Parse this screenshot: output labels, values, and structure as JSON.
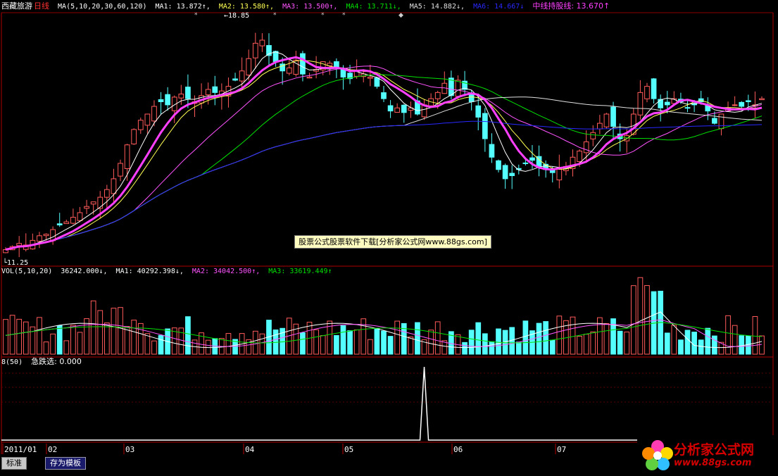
{
  "header": {
    "stock_name": "西藏旅游",
    "period": "日线",
    "ma_params": "MA(5,10,20,30,60,120)",
    "ma1": "MA1: 13.872↑,",
    "ma2": "MA2: 13.580↑,",
    "ma3": "MA3: 13.500↑,",
    "ma4": "MA4: 13.711↓,",
    "ma5": "MA5: 14.882↓,",
    "ma6": "MA6: 14.667↓",
    "midline": "中线持股线: 13.670↑"
  },
  "vol_header": {
    "params": "VOL(5,10,20)",
    "vol": "36242.000↓,",
    "ma1": "MA1: 40292.398↓,",
    "ma2": "MA2: 34042.500↑,",
    "ma3": "MA3: 33619.449↑"
  },
  "indicator_header": {
    "params": "8(50)",
    "label": "急跌选: 0.000"
  },
  "annotations": {
    "high": "18.85",
    "low": "11.25"
  },
  "watermark": "股票公式股票软件下载[分析家公式网www.88gs.com]",
  "toolbar": {
    "tab_normal": "标准",
    "tab_save": "存为模板"
  },
  "logo": {
    "title": "分析家公式网",
    "url": "www.88gs.com"
  },
  "colors": {
    "up": "#ff5a5a",
    "down": "#54ffff",
    "ma1": "#ffffff",
    "ma2": "#ffff54",
    "ma3": "#ff54ff",
    "ma4": "#00e000",
    "ma5": "#e0e0e0",
    "ma6": "#2828ff",
    "midline": "#ff40ff"
  },
  "chart_data": {
    "type": "candlestick",
    "x_axis_labels": [
      "2011/01",
      "02",
      "03",
      "04",
      "05",
      "06",
      "07"
    ],
    "price_range": [
      11.25,
      18.85
    ],
    "price_high_label": 18.85,
    "price_low_label": 11.25,
    "closes": [
      11.4,
      11.5,
      11.6,
      11.55,
      11.7,
      11.85,
      11.9,
      12.05,
      12.2,
      12.3,
      12.45,
      12.6,
      12.8,
      12.95,
      13.1,
      13.35,
      13.7,
      14.2,
      14.8,
      15.3,
      15.6,
      15.8,
      16.05,
      16.2,
      16.1,
      16.35,
      16.45,
      16.3,
      16.2,
      16.4,
      16.6,
      16.5,
      16.55,
      16.7,
      16.9,
      17.2,
      17.6,
      18.1,
      18.2,
      17.7,
      17.5,
      17.2,
      17.3,
      17.55,
      17.1,
      17.0,
      17.25,
      17.5,
      17.45,
      17.3,
      17.0,
      16.95,
      17.2,
      17.1,
      17.0,
      16.7,
      16.3,
      15.9,
      16.0,
      15.85,
      16.0,
      15.8,
      16.1,
      16.3,
      16.5,
      16.8,
      16.4,
      16.9,
      16.6,
      16.2,
      15.7,
      15.0,
      14.4,
      14.0,
      13.7,
      13.8,
      14.0,
      14.2,
      14.3,
      14.1,
      14.0,
      13.9,
      14.05,
      14.1,
      14.4,
      14.6,
      14.9,
      15.2,
      15.5,
      15.8,
      15.4,
      15.0,
      15.1,
      15.8,
      16.5,
      16.7,
      16.3,
      16.0,
      16.1,
      16.3,
      16.2,
      16.0,
      16.1,
      16.2,
      15.9,
      15.5,
      15.8,
      16.0,
      16.1,
      16.05,
      16.2,
      16.1,
      16.3
    ],
    "volume_range": [
      0,
      100000
    ],
    "volume_bars": 110,
    "indicator": {
      "name": "急跌选",
      "spike_at_index": 62,
      "value": 0.0
    }
  }
}
